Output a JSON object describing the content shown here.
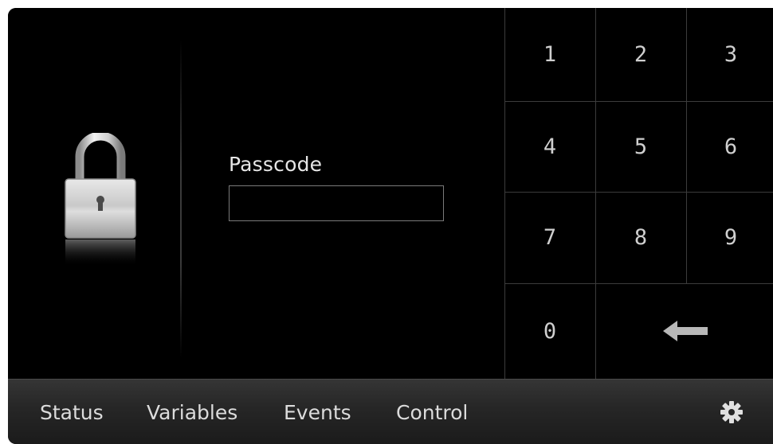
{
  "passcode": {
    "label": "Passcode",
    "value": "",
    "placeholder": ""
  },
  "keypad": {
    "keys": [
      "1",
      "2",
      "3",
      "4",
      "5",
      "6",
      "7",
      "8",
      "9",
      "0"
    ],
    "enter_icon": "enter-arrow-icon"
  },
  "icons": {
    "lock": "padlock-icon",
    "settings": "gear-icon"
  },
  "nav": {
    "items": [
      "Status",
      "Variables",
      "Events",
      "Control"
    ]
  },
  "colors": {
    "background": "#000000",
    "text": "#e6e6e6",
    "keypad_text": "#cfcfcf",
    "grid_lines": "#3c3c3c",
    "nav_bar": "#262626"
  }
}
